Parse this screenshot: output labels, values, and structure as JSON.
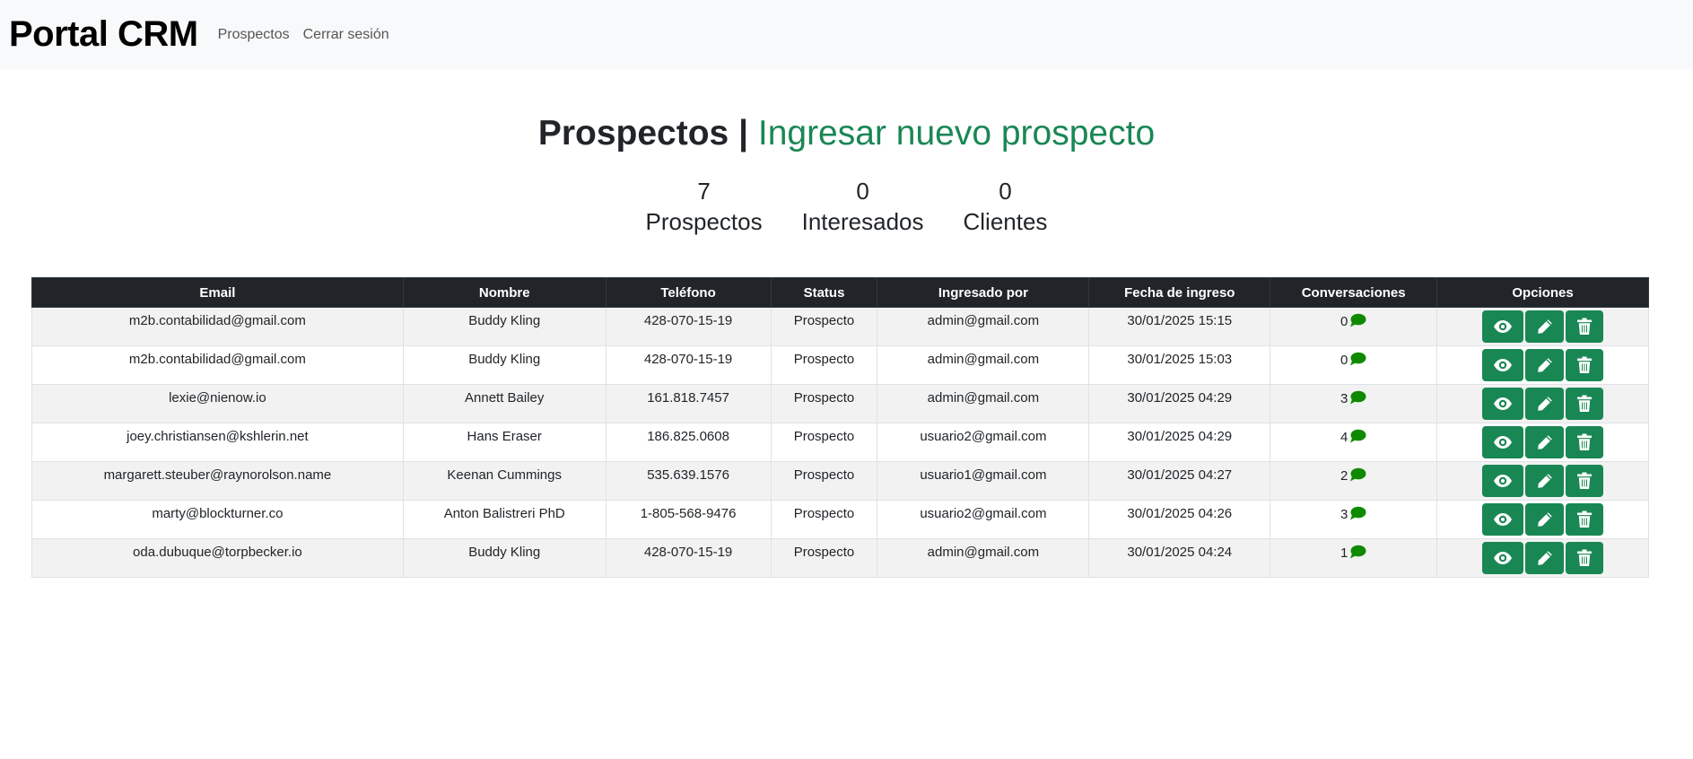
{
  "nav": {
    "brand": "Portal CRM",
    "links": [
      "Prospectos",
      "Cerrar sesión"
    ]
  },
  "header": {
    "title": "Prospectos",
    "separator": "|",
    "link": "Ingresar nuevo prospecto"
  },
  "stats": [
    {
      "value": "7",
      "label": "Prospectos"
    },
    {
      "value": "0",
      "label": "Interesados"
    },
    {
      "value": "0",
      "label": "Clientes"
    }
  ],
  "table": {
    "headers": [
      "Email",
      "Nombre",
      "Teléfono",
      "Status",
      "Ingresado por",
      "Fecha de ingreso",
      "Conversaciones",
      "Opciones"
    ],
    "rows": [
      {
        "email": "m2b.contabilidad@gmail.com",
        "nombre": "Buddy Kling",
        "telefono": "428-070-15-19",
        "status": "Prospecto",
        "ingresado_por": "admin@gmail.com",
        "fecha": "30/01/2025 15:15",
        "conversaciones": "0"
      },
      {
        "email": "m2b.contabilidad@gmail.com",
        "nombre": "Buddy Kling",
        "telefono": "428-070-15-19",
        "status": "Prospecto",
        "ingresado_por": "admin@gmail.com",
        "fecha": "30/01/2025 15:03",
        "conversaciones": "0"
      },
      {
        "email": "lexie@nienow.io",
        "nombre": "Annett Bailey",
        "telefono": "161.818.7457",
        "status": "Prospecto",
        "ingresado_por": "admin@gmail.com",
        "fecha": "30/01/2025 04:29",
        "conversaciones": "3"
      },
      {
        "email": "joey.christiansen@kshlerin.net",
        "nombre": "Hans Eraser",
        "telefono": "186.825.0608",
        "status": "Prospecto",
        "ingresado_por": "usuario2@gmail.com",
        "fecha": "30/01/2025 04:29",
        "conversaciones": "4"
      },
      {
        "email": "margarett.steuber@raynorolson.name",
        "nombre": "Keenan Cummings",
        "telefono": "535.639.1576",
        "status": "Prospecto",
        "ingresado_por": "usuario1@gmail.com",
        "fecha": "30/01/2025 04:27",
        "conversaciones": "2"
      },
      {
        "email": "marty@blockturner.co",
        "nombre": "Anton Balistreri PhD",
        "telefono": "1-805-568-9476",
        "status": "Prospecto",
        "ingresado_por": "usuario2@gmail.com",
        "fecha": "30/01/2025 04:26",
        "conversaciones": "3"
      },
      {
        "email": "oda.dubuque@torpbecker.io",
        "nombre": "Buddy Kling",
        "telefono": "428-070-15-19",
        "status": "Prospecto",
        "ingresado_por": "admin@gmail.com",
        "fecha": "30/01/2025 04:24",
        "conversaciones": "1"
      }
    ]
  },
  "icons": {
    "conversation": "chat-bubble-icon",
    "view": "eye-icon",
    "edit": "pencil-icon",
    "delete": "trash-icon"
  },
  "colors": {
    "accent": "#198754",
    "chat_icon": "#0f8a00",
    "table_header_bg": "#212529",
    "navbar_bg": "#f8f9fa"
  }
}
